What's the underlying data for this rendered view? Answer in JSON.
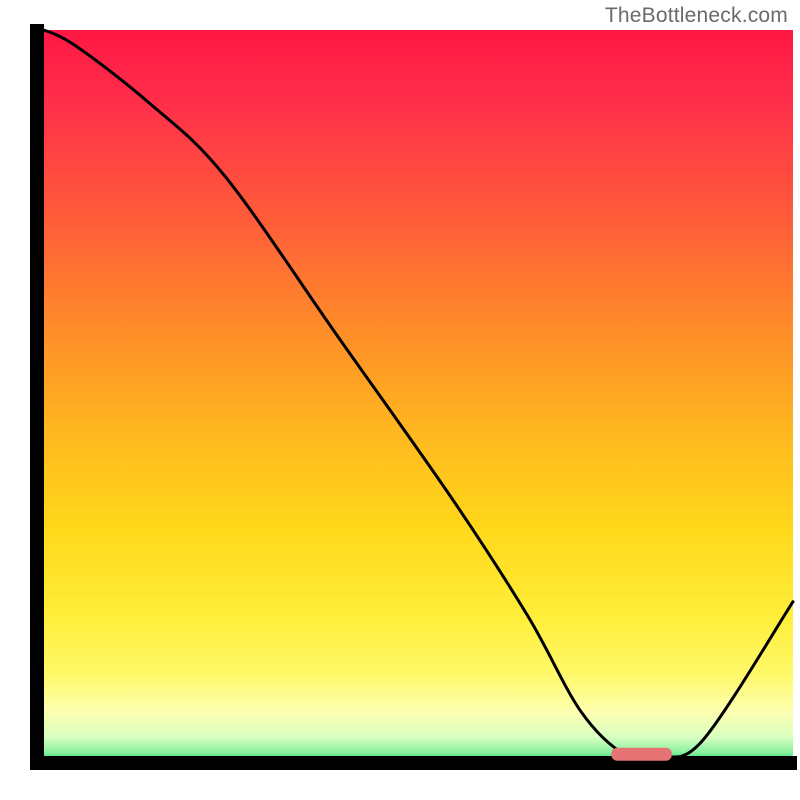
{
  "watermark": "TheBottleneck.com",
  "colors": {
    "axis": "#000000",
    "curve": "#000000",
    "marker_fill": "#e57373",
    "gradient_stops": [
      {
        "offset": 0.0,
        "color": "#ff1744"
      },
      {
        "offset": 0.1,
        "color": "#ff2f4a"
      },
      {
        "offset": 0.25,
        "color": "#ff5a3a"
      },
      {
        "offset": 0.4,
        "color": "#ff8a2a"
      },
      {
        "offset": 0.55,
        "color": "#ffb81f"
      },
      {
        "offset": 0.68,
        "color": "#ffd81a"
      },
      {
        "offset": 0.8,
        "color": "#ffee3a"
      },
      {
        "offset": 0.88,
        "color": "#fff96a"
      },
      {
        "offset": 0.93,
        "color": "#fdffb0"
      },
      {
        "offset": 0.965,
        "color": "#d7ffc0"
      },
      {
        "offset": 0.985,
        "color": "#8cf0a0"
      },
      {
        "offset": 1.0,
        "color": "#18d66a"
      }
    ]
  },
  "chart_data": {
    "type": "line",
    "title": "",
    "xlabel": "",
    "ylabel": "",
    "xlim": [
      0,
      100
    ],
    "ylim": [
      0,
      100
    ],
    "x": [
      0,
      5,
      15,
      25,
      40,
      55,
      65,
      72,
      78,
      82,
      88,
      100
    ],
    "values": [
      102,
      98,
      90,
      80,
      58,
      36,
      20,
      7,
      1,
      1,
      3,
      22
    ],
    "optimum_marker": {
      "x_start": 76,
      "x_end": 84,
      "y": 1.2
    },
    "note": "Values are bottleneck-percentage-like metric read off a gradient chart; y=0 is optimal (green), y=100 is worst (red). The curve starts near the top-left, has a near-linear descent with a slight knee around x≈25, reaches a flat minimum around x≈76–84 where the pink marker sits, then rises toward the right edge."
  }
}
